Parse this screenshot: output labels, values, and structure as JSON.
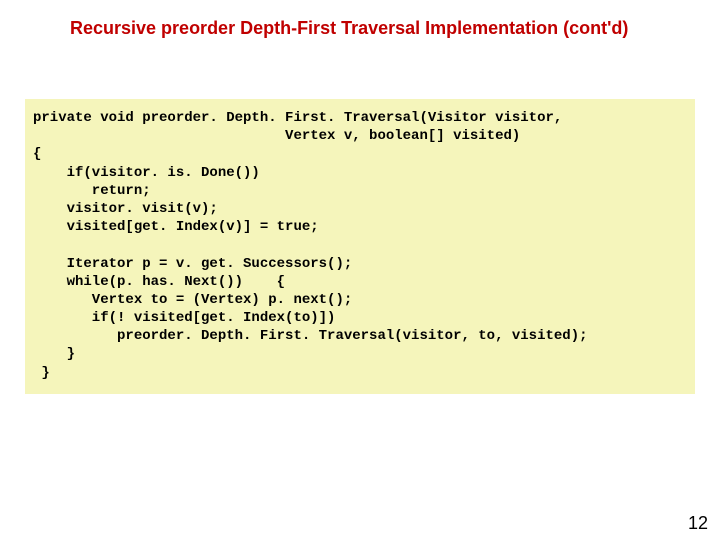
{
  "title": "Recursive preorder Depth-First Traversal Implementation (cont'd)",
  "code": "private void preorder. Depth. First. Traversal(Visitor visitor,\n                              Vertex v, boolean[] visited)\n{\n    if(visitor. is. Done())\n       return;\n    visitor. visit(v);\n    visited[get. Index(v)] = true;\n\n    Iterator p = v. get. Successors();\n    while(p. has. Next())    {\n       Vertex to = (Vertex) p. next();\n       if(! visited[get. Index(to)])\n          preorder. Depth. First. Traversal(visitor, to, visited);\n    }\n }",
  "page_number": "12"
}
